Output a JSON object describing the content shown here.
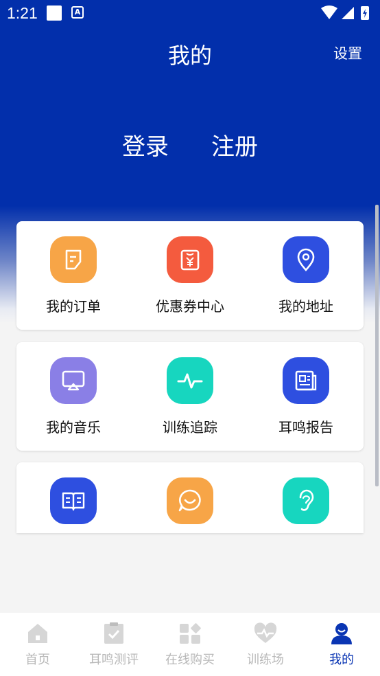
{
  "status": {
    "time": "1:21"
  },
  "header": {
    "title": "我的",
    "settings_label": "设置"
  },
  "auth": {
    "login": "登录",
    "register": "注册"
  },
  "grid": [
    {
      "label": "我的订单",
      "icon": "order-icon",
      "color": "#f7a547"
    },
    {
      "label": "优惠券中心",
      "icon": "coupon-icon",
      "color": "#f45b3e"
    },
    {
      "label": "我的地址",
      "icon": "location-pin-icon",
      "color": "#2e4fe0"
    },
    {
      "label": "我的音乐",
      "icon": "music-screen-icon",
      "color": "#8a7fe6"
    },
    {
      "label": "训练追踪",
      "icon": "pulse-icon",
      "color": "#17d6bf"
    },
    {
      "label": "耳鸣报告",
      "icon": "report-icon",
      "color": "#2e4fe0"
    },
    {
      "label": "",
      "icon": "book-icon",
      "color": "#2e4fe0"
    },
    {
      "label": "",
      "icon": "chat-smile-icon",
      "color": "#f7a547"
    },
    {
      "label": "",
      "icon": "ear-icon",
      "color": "#17d6bf"
    }
  ],
  "tabs": [
    {
      "label": "首页",
      "icon": "home-icon"
    },
    {
      "label": "耳鸣测评",
      "icon": "checklist-icon"
    },
    {
      "label": "在线购买",
      "icon": "grid-shop-icon"
    },
    {
      "label": "训练场",
      "icon": "heart-pulse-icon"
    },
    {
      "label": "我的",
      "icon": "user-icon",
      "active": true
    }
  ],
  "colors": {
    "primary": "#022fab",
    "tab_active": "#0a35b3",
    "tab_inactive": "#b8b8b8"
  }
}
